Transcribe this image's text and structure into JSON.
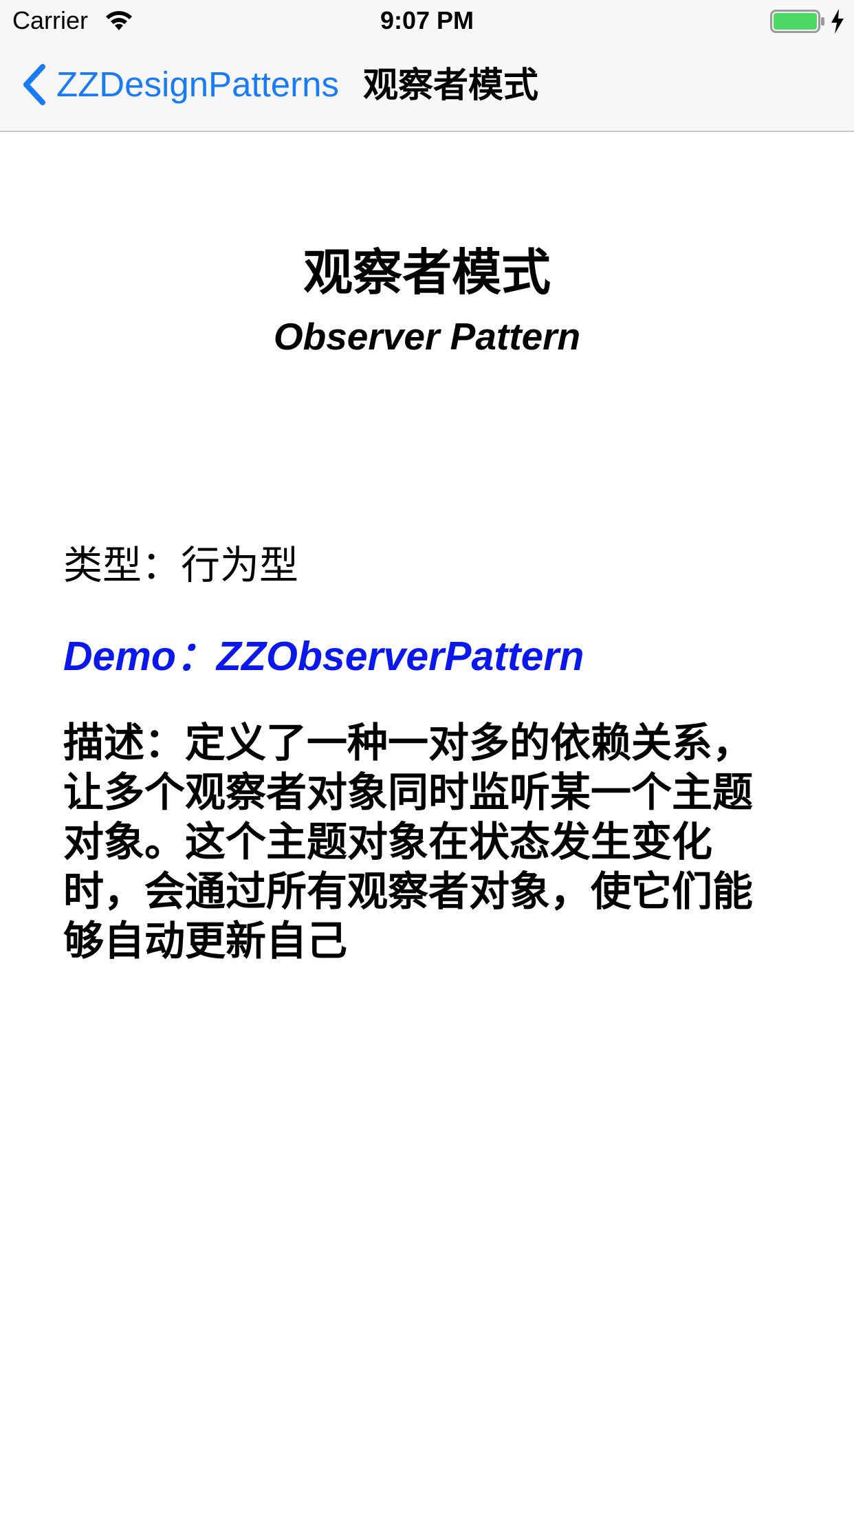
{
  "status_bar": {
    "carrier": "Carrier",
    "time": "9:07 PM",
    "wifi_icon": "wifi-icon",
    "battery_icon": "battery-charging-icon",
    "battery_color": "#4cd964"
  },
  "nav": {
    "back_label": "ZZDesignPatterns",
    "back_icon": "chevron-left-icon",
    "title": "观察者模式",
    "accent_color": "#1a7bf7"
  },
  "content": {
    "heading_cn": "观察者模式",
    "heading_en": "Observer Pattern",
    "type_text": "类型：行为型",
    "demo_text": "Demo：ZZObserverPattern",
    "demo_color": "#0a18ee",
    "description": "描述：定义了一种一对多的依赖关系，让多个观察者对象同时监听某一个主题对象。这个主题对象在状态发生变化时，会通过所有观察者对象，使它们能够自动更新自己"
  }
}
